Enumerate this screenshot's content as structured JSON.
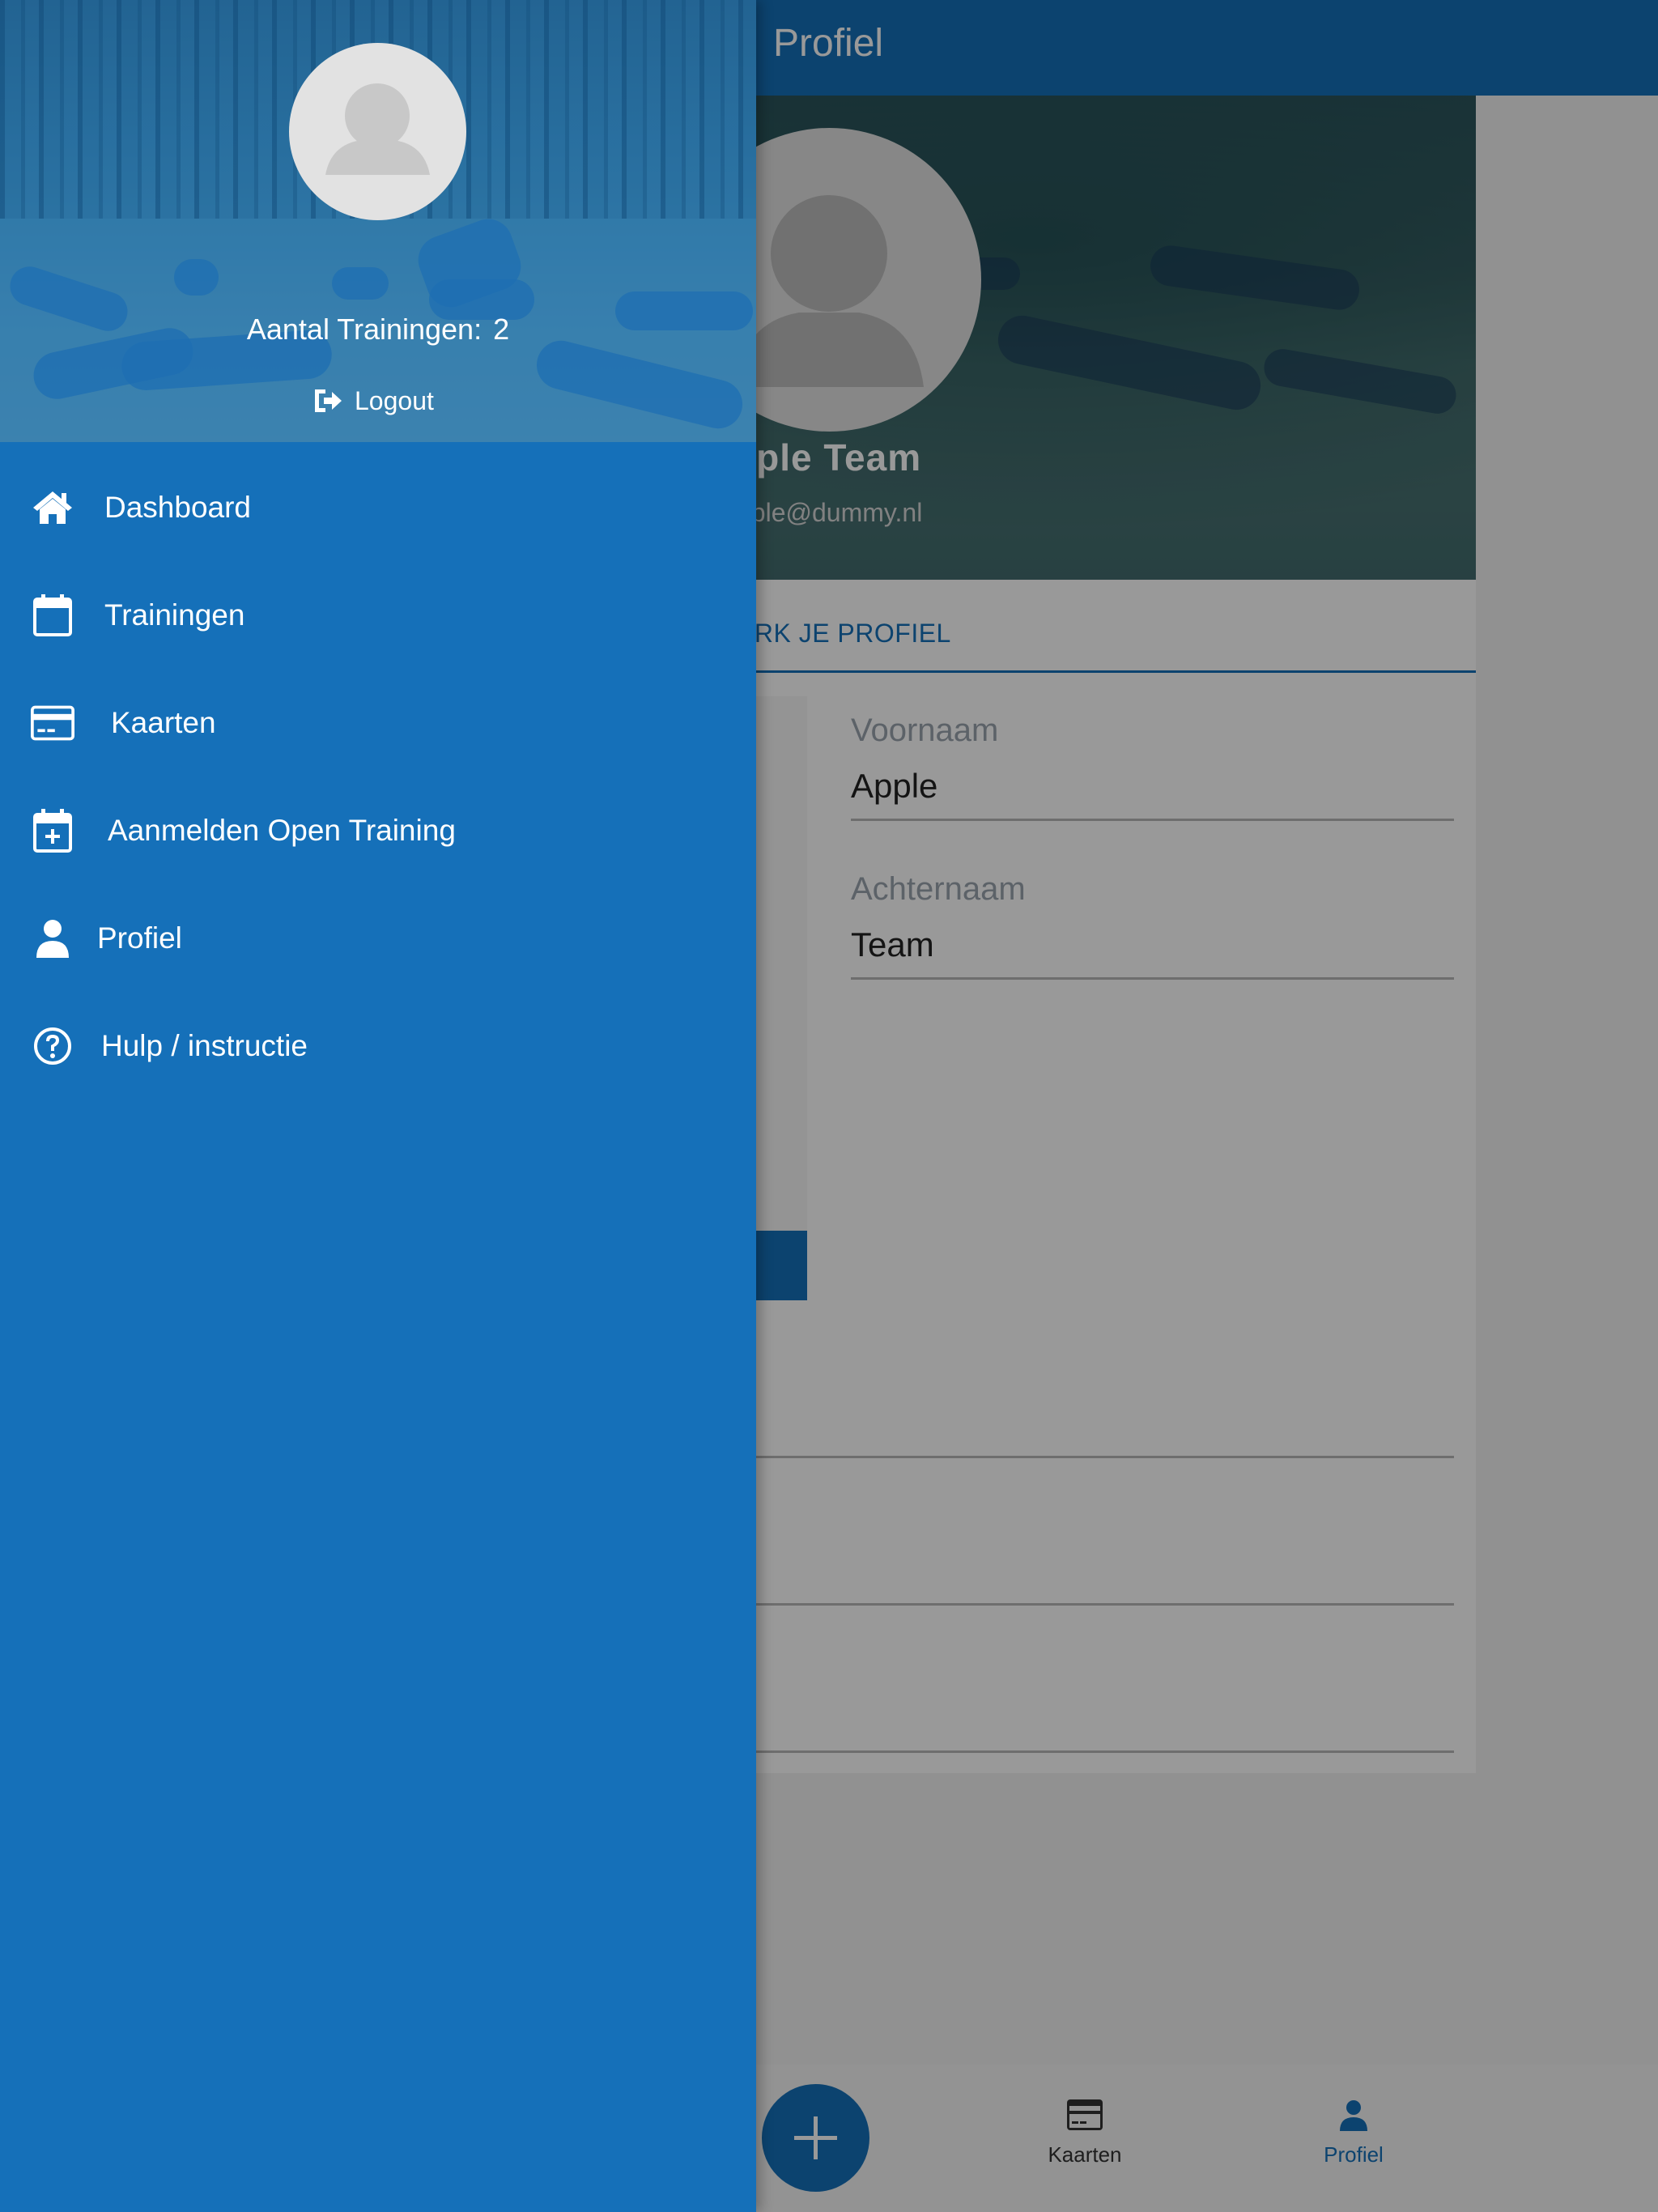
{
  "header": {
    "title": "Profiel"
  },
  "profile": {
    "name": "pple Team",
    "email": "pple@dummy.nl",
    "tab_label": "ERK JE PROFIEL",
    "fields": [
      {
        "label": "Voornaam",
        "value": "Apple"
      },
      {
        "label": "Achternaam",
        "value": "Team"
      }
    ]
  },
  "drawer": {
    "training_count_label": "Aantal Trainingen:",
    "training_count": "2",
    "logout_label": "Logout",
    "menu": [
      {
        "label": "Dashboard",
        "icon": "home-icon"
      },
      {
        "label": "Trainingen",
        "icon": "calendar-icon"
      },
      {
        "label": "Kaarten",
        "icon": "credit-card-icon"
      },
      {
        "label": "Aanmelden Open Training",
        "icon": "calendar-plus-icon"
      },
      {
        "label": "Profiel",
        "icon": "user-icon"
      },
      {
        "label": "Hulp / instructie",
        "icon": "question-circle-icon"
      }
    ]
  },
  "bottom_tabs": [
    {
      "label": "Kaarten",
      "icon": "credit-card-icon"
    },
    {
      "label": "Profiel",
      "icon": "user-icon",
      "active": true
    }
  ],
  "fab": {
    "icon": "plus-icon"
  },
  "colors": {
    "primary": "#1570b9",
    "drawer": "#1570b9",
    "text_light": "#ffffff"
  }
}
